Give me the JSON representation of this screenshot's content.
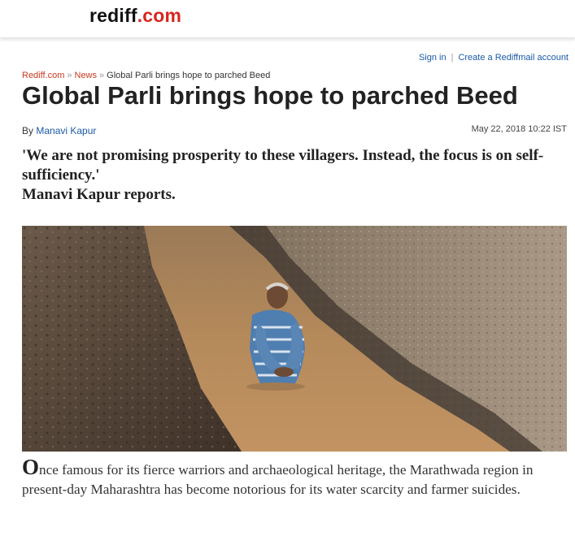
{
  "site": {
    "logo_part1": "rediff",
    "logo_part2": ".com"
  },
  "account": {
    "sign_in": "Sign in",
    "separator": "|",
    "create": "Create a Rediffmail account"
  },
  "breadcrumb": {
    "home": "Rediff.com",
    "arrow": "»",
    "section": "News",
    "current": "Global Parli brings hope to parched Beed"
  },
  "article": {
    "title": "Global Parli brings hope to parched Beed",
    "by_prefix": "By",
    "author": "Manavi Kapur",
    "date": "May 22, 2018 10:22 IST",
    "deck_line1": "'We are not promising prosperity to these villagers. Instead, the focus is on self-sufficiency.'",
    "deck_line2": "Manavi Kapur reports.",
    "lede_dropcap": "O",
    "lede_rest": "nce famous for its fierce warriors and archaeological heritage, the Marathwada region in present-day Maharashtra has become notorious for its water scarcity and farmer suicides."
  },
  "colors": {
    "brand_red": "#d7261e",
    "link_blue": "#1a5aa8",
    "crumb_orange": "#c8391e"
  }
}
